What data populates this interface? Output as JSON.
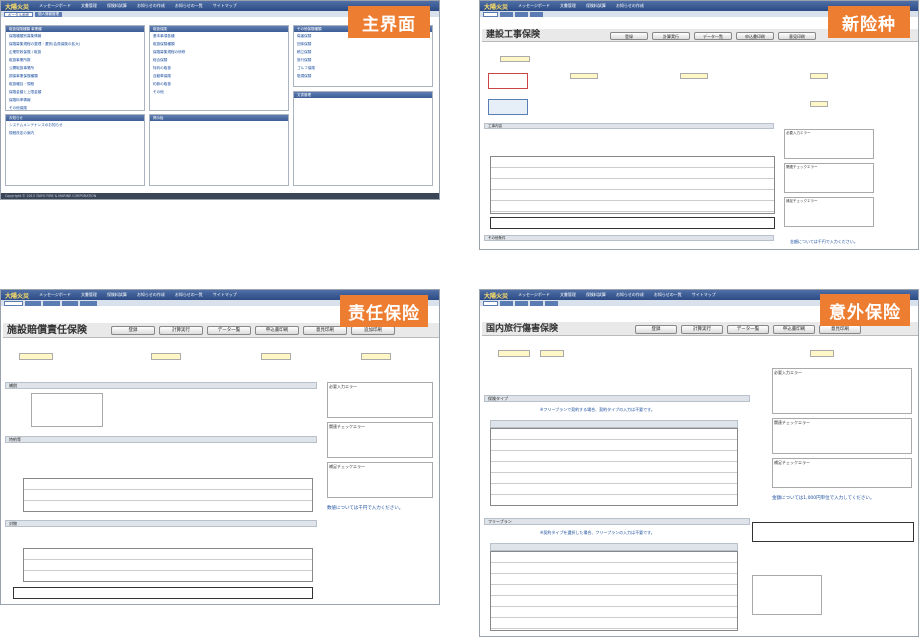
{
  "tags": {
    "main": "主界面",
    "new_type": "新险种",
    "liability": "责任保险",
    "accident": "意外保险"
  },
  "app": {
    "logo": "大陽火災",
    "nav": [
      "メッセージボード",
      "文書管理",
      "保険料試算",
      "お知らせの作成",
      "お知らせの一覧",
      "サイトマップ"
    ]
  },
  "main_screen": {
    "tabs": [
      "ポータル画面",
      "個人情報管理"
    ],
    "panels": [
      {
        "title": "取扱保険種類 事業種",
        "items": [
          "保険種類別募集情報",
          "保険募集規程の整理・選別(会員保険の拡大)",
          "企業財政保険 / 取扱",
          "取扱事業所数",
          "公開取扱事業所",
          "損保事業保険種類",
          "取扱種目・規程",
          "保険金額と上限金額",
          "保険料率情報",
          "その他保険",
          "口座振替"
        ]
      },
      {
        "title": "取扱保険",
        "items": [
          "基本事項各種",
          "取扱保険種類",
          "保険募集規程の研修",
          "総合保険",
          "特約の取扱",
          "自動車保険",
          "約款の取扱",
          "その他"
        ]
      },
      {
        "title": "その他保険種類",
        "items": [
          "傷害保険",
          "団体保険",
          "積立保険",
          "旅行保険",
          "ゴルフ保険",
          "賠償保険"
        ]
      },
      {
        "title": "お知らせ",
        "items": [
          "システムメンテナンスのお知らせ",
          "規程改定の案内"
        ]
      },
      {
        "title": "掲示板",
        "items": []
      },
      {
        "title": "文書管理",
        "items": []
      }
    ],
    "footer": "Copyright © 2013 TAIYO FIRE & MARINE CORPORATION"
  },
  "new_type_screen": {
    "title": "建設工事保険",
    "buttons": [
      "登録",
      "計算実行",
      "データ一覧",
      "申込書印刷",
      "意見印刷"
    ],
    "sections": [
      "工事内容",
      "その他条件"
    ],
    "note": "金額については千円で入力ください。",
    "side_labels": [
      "必要入力エラー",
      "関連チェックエラー",
      "補足チェックエラー"
    ]
  },
  "liability_screen": {
    "title": "施設賠償責任保険",
    "buttons": [
      "登録",
      "計算実行",
      "データ一覧",
      "申込書印刷",
      "意見印刷",
      "追加印刷"
    ],
    "sections": [
      "補償",
      "特約等",
      "対人",
      "対物"
    ],
    "note": "数値については千円で入力ください。",
    "side_labels": [
      "必要入力エラー",
      "関連チェックエラー",
      "補足チェックエラー"
    ]
  },
  "accident_screen": {
    "title": "国内旅行傷害保険",
    "buttons": [
      "登録",
      "計算実行",
      "データ一覧",
      "申込書印刷",
      "意見印刷"
    ],
    "sections": [
      "保険タイプ",
      "フリープラン"
    ],
    "note": "金額については1,000円単位で入力してください。",
    "plan_note": "※フリープランで契約する場合、契約タイプの入力は不要です。",
    "free_note": "※契約タイプを選択した場合、フリープランの入力は不要です。",
    "side_labels": [
      "必要入力エラー",
      "関連チェックエラー",
      "補足チェックエラー"
    ],
    "rows": [
      "死亡・後遺障害",
      "入院保険金日額",
      "通院保険金日額",
      "疾病死亡",
      "治療費用",
      "救援者費用",
      "賠償責任"
    ]
  }
}
